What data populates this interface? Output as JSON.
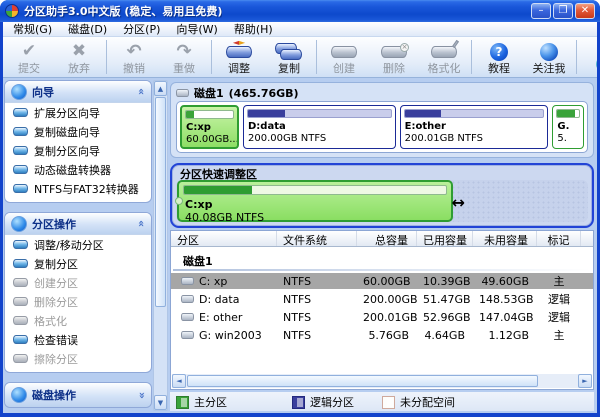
{
  "window": {
    "title": "分区助手3.0中文版 (稳定、易用且免费)",
    "controls": [
      {
        "name": "minimize",
        "glyph": "–"
      },
      {
        "name": "maximize",
        "glyph": "❐"
      },
      {
        "name": "close",
        "glyph": "✕"
      }
    ]
  },
  "menu": {
    "items": [
      {
        "label": "常规(G)"
      },
      {
        "label": "磁盘(D)"
      },
      {
        "label": "分区(P)"
      },
      {
        "label": "向导(W)"
      },
      {
        "label": "帮助(H)"
      }
    ]
  },
  "toolbar": {
    "buttons": [
      {
        "label": "提交",
        "enabled": false,
        "icon": "commit-check-icon"
      },
      {
        "label": "放弃",
        "enabled": false,
        "icon": "discard-cross-icon"
      },
      {
        "label": "撤销",
        "enabled": false,
        "icon": "undo-arrow-icon"
      },
      {
        "label": "重做",
        "enabled": false,
        "icon": "redo-arrow-icon"
      },
      {
        "label": "调整",
        "enabled": true,
        "icon": "resize-disk-icon"
      },
      {
        "label": "复制",
        "enabled": true,
        "icon": "copy-disk-icon"
      },
      {
        "label": "创建",
        "enabled": false,
        "icon": "create-disk-icon"
      },
      {
        "label": "删除",
        "enabled": false,
        "icon": "delete-disk-icon"
      },
      {
        "label": "格式化",
        "enabled": false,
        "icon": "format-disk-icon"
      },
      {
        "label": "教程",
        "enabled": true,
        "icon": "tutorial-help-icon"
      },
      {
        "label": "关注我",
        "enabled": true,
        "icon": "follow-globe-icon"
      },
      {
        "label": "",
        "enabled": true,
        "icon": "clipped-icon"
      }
    ]
  },
  "sidebar": {
    "sections": [
      {
        "title": "向导",
        "state": "expanded",
        "items": [
          {
            "label": "扩展分区向导",
            "enabled": true
          },
          {
            "label": "复制磁盘向导",
            "enabled": true
          },
          {
            "label": "复制分区向导",
            "enabled": true
          },
          {
            "label": "动态磁盘转换器",
            "enabled": true
          },
          {
            "label": "NTFS与FAT32转换器",
            "enabled": true
          }
        ]
      },
      {
        "title": "分区操作",
        "state": "expanded",
        "items": [
          {
            "label": "调整/移动分区",
            "enabled": true
          },
          {
            "label": "复制分区",
            "enabled": true
          },
          {
            "label": "创建分区",
            "enabled": false
          },
          {
            "label": "删除分区",
            "enabled": false
          },
          {
            "label": "格式化",
            "enabled": false
          },
          {
            "label": "检查错误",
            "enabled": true
          },
          {
            "label": "擦除分区",
            "enabled": false
          }
        ]
      },
      {
        "title": "磁盘操作",
        "state": "collapsed",
        "items": []
      }
    ]
  },
  "disk_map": {
    "disk_label": "磁盘1",
    "disk_size": "(465.76GB)",
    "partitions": [
      {
        "name": "C:xp",
        "info": "60.00GB...",
        "type": "primary",
        "selected": true,
        "used_pct": 17,
        "width_pct": 15
      },
      {
        "name": "D:data",
        "info": "200.00GB NTFS",
        "type": "logical",
        "selected": false,
        "used_pct": 26,
        "width_pct": 39
      },
      {
        "name": "E:other",
        "info": "200.01GB NTFS",
        "type": "logical",
        "selected": false,
        "used_pct": 26,
        "width_pct": 38
      },
      {
        "name": "G.",
        "info": "5.",
        "type": "primary",
        "selected": false,
        "used_pct": 80,
        "width_pct": 8
      }
    ]
  },
  "quick_adjust": {
    "title": "分区快速调整区",
    "name": "C:xp",
    "info": "40.08GB NTFS",
    "used_pct": 26,
    "width_pct": 67
  },
  "table": {
    "columns": [
      "分区",
      "文件系统",
      "总容量",
      "已用容量",
      "未用容量",
      "标记"
    ],
    "group_label": "磁盘1",
    "rows": [
      {
        "name": "C: xp",
        "fs": "NTFS",
        "total": "60.00GB",
        "used": "10.39GB",
        "free": "49.60GB",
        "flag": "主",
        "selected": true
      },
      {
        "name": "D: data",
        "fs": "NTFS",
        "total": "200.00GB",
        "used": "51.47GB",
        "free": "148.53GB",
        "flag": "逻辑",
        "selected": false
      },
      {
        "name": "E: other",
        "fs": "NTFS",
        "total": "200.01GB",
        "used": "52.96GB",
        "free": "147.04GB",
        "flag": "逻辑",
        "selected": false
      },
      {
        "name": "G: win2003",
        "fs": "NTFS",
        "total": "5.76GB",
        "used": "4.64GB",
        "free": "1.12GB",
        "flag": "主",
        "selected": false
      }
    ]
  },
  "legend": {
    "items": [
      {
        "label": "主分区",
        "color": "#3aa33a"
      },
      {
        "label": "逻辑分区",
        "color": "#3a3f9d"
      },
      {
        "label": "未分配空间",
        "color": "#fdfdfb"
      }
    ]
  },
  "colors": {
    "titlebar_blue": "#0f54d7",
    "primary_green": "#3aa33a",
    "logical_blue": "#3a3f9d",
    "selection_gray": "#a6a6a6",
    "quick_border_blue": "#2244d6"
  }
}
